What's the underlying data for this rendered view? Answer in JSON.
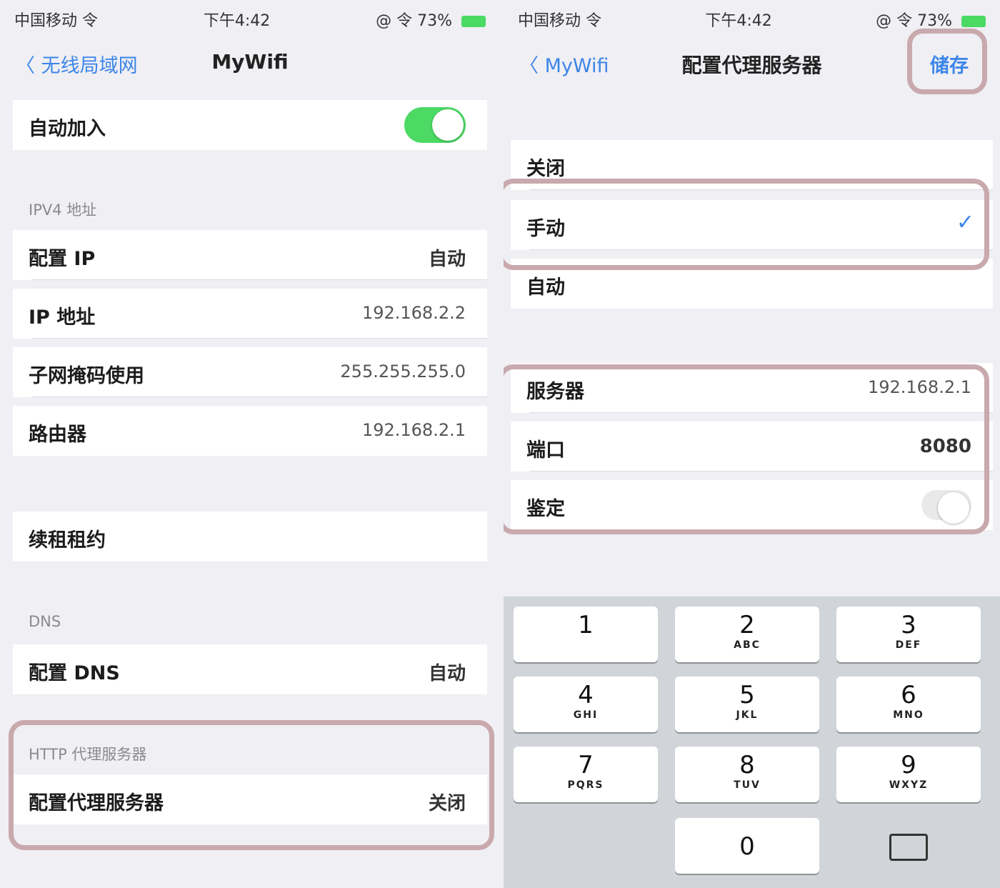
{
  "left": {
    "status": {
      "time": "中国移动 令",
      "center": "下午4:42",
      "right": "@ 令 73% "
    },
    "nav": {
      "back": "〈 无线局域网",
      "title": "MyWifi"
    },
    "auto_join": {
      "label": "自动加入"
    },
    "ipv4": {
      "header": "IPV4 地址",
      "rows": [
        {
          "label": "配置 IP",
          "value": "自动"
        },
        {
          "label": "IP 地址",
          "value": "192.168.2.2"
        },
        {
          "label": "子网掩码使用",
          "value": "255.255.255.0"
        },
        {
          "label": "路由器",
          "value": "192.168.2.1"
        }
      ]
    },
    "renew": {
      "label": "续租租约"
    },
    "dns": {
      "header": "DNS",
      "row": {
        "label": "配置 DNS",
        "value": "自动"
      }
    },
    "proxy": {
      "header": "HTTP 代理服务器",
      "row": {
        "label": "配置代理服务器",
        "value": "关闭"
      }
    }
  },
  "right": {
    "status": {
      "time": "中国移动 令",
      "center": "下午4:42",
      "right": "@ 令 73% "
    },
    "nav": {
      "back": "〈 MyWifi",
      "title": "配置代理服务器",
      "action": "储存"
    },
    "options": [
      {
        "label": "关闭",
        "selected": false
      },
      {
        "label": "手动",
        "selected": true
      },
      {
        "label": "自动",
        "selected": false
      }
    ],
    "check_icon": "✓",
    "manual": [
      {
        "label": "服务器",
        "value": "192.168.2.1"
      },
      {
        "label": "端口",
        "value": "8080"
      },
      {
        "label": "鉴定",
        "value": ""
      }
    ],
    "keyboard": {
      "keys": [
        {
          "num": "1",
          "letters": ""
        },
        {
          "num": "2",
          "letters": "ABC"
        },
        {
          "num": "3",
          "letters": "DEF"
        },
        {
          "num": "4",
          "letters": "GHI"
        },
        {
          "num": "5",
          "letters": "JKL"
        },
        {
          "num": "6",
          "letters": "MNO"
        },
        {
          "num": "7",
          "letters": "PQRS"
        },
        {
          "num": "8",
          "letters": "TUV"
        },
        {
          "num": "9",
          "letters": "WXYZ"
        },
        {
          "num": "0",
          "letters": ""
        }
      ],
      "delete_icon": "backspace-icon"
    }
  },
  "colors": {
    "accent": "#3d86e8",
    "toggle_on": "#4cd964",
    "highlight": "#c9a9ad"
  }
}
